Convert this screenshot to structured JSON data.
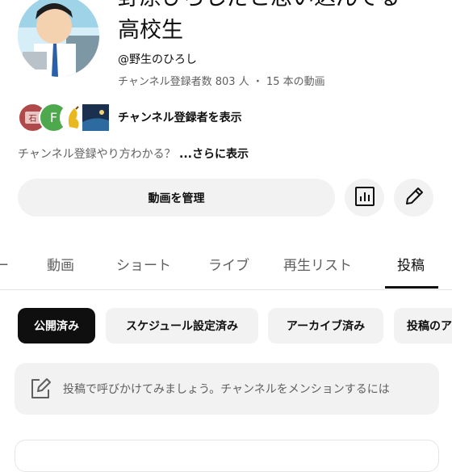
{
  "channel": {
    "title_line1": "野原ひろしだと思い込んでる",
    "title_line2": "高校生",
    "handle": "@野生のひろし",
    "stats": "チャンネル登録者数 803 人 ・ 15 本の動画",
    "subscribers_label": "チャンネル登録者を表示",
    "subscriber_initial": "F",
    "description": "チャンネル登録やり方わかる？ ",
    "more_label": "...さらに表示"
  },
  "actions": {
    "manage_label": "動画を管理",
    "analytics_icon": "analytics-icon",
    "edit_icon": "pencil-icon"
  },
  "tabs": [
    {
      "label": "動画"
    },
    {
      "label": "ショート"
    },
    {
      "label": "ライブ"
    },
    {
      "label": "再生リスト"
    },
    {
      "label": "投稿"
    }
  ],
  "active_tab": "投稿",
  "chips": [
    {
      "label": "公開済み"
    },
    {
      "label": "スケジュール設定済み"
    },
    {
      "label": "アーカイブ済み"
    },
    {
      "label": "投稿のア"
    }
  ],
  "compose": {
    "placeholder": "投稿で呼びかけてみましょう。チャンネルをメンションするには"
  },
  "colors": {
    "text_primary": "#0f0f0f",
    "text_secondary": "#606060",
    "chip_bg": "#f2f2f2",
    "chip_active_bg": "#0f0f0f"
  }
}
